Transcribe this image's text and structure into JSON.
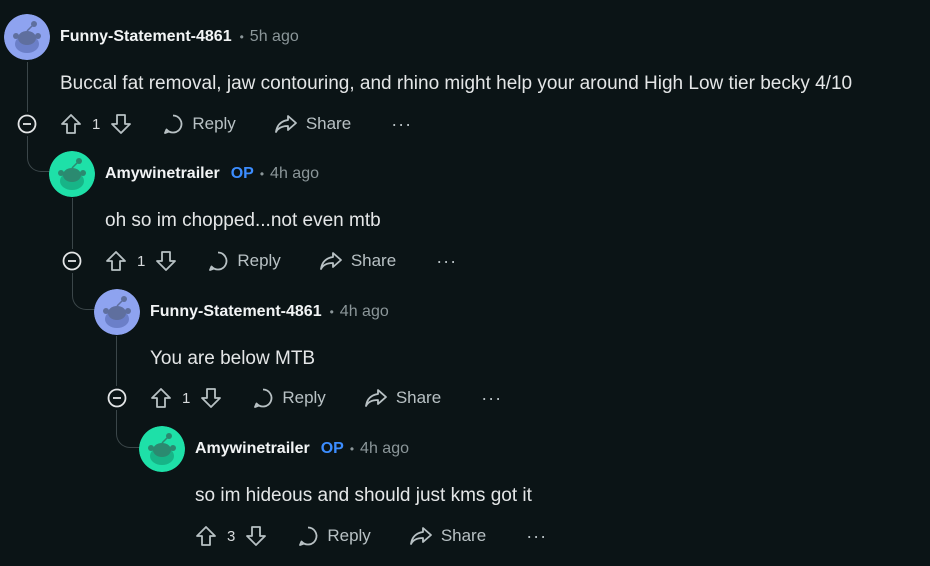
{
  "colors": {
    "bg": "#0b1416",
    "op": "#3c8dff",
    "avatar_blue": "#8ea3f0",
    "avatar_green": "#1ee0a8"
  },
  "comments": [
    {
      "username": "Funny-Statement-4861",
      "op": "",
      "time": "5h ago",
      "text": "Buccal fat removal, jaw contouring, and rhino might help your around High Low tier becky 4/10",
      "votes": "1",
      "reply": "Reply",
      "share": "Share",
      "more": "···",
      "avatar": "snoo-avatar-blue"
    },
    {
      "username": "Amywinetrailer",
      "op": "OP",
      "time": "4h ago",
      "text": "oh so im chopped...not even mtb",
      "votes": "1",
      "reply": "Reply",
      "share": "Share",
      "more": "···",
      "avatar": "snoo-avatar-green"
    },
    {
      "username": "Funny-Statement-4861",
      "op": "",
      "time": "4h ago",
      "text": "You are below MTB",
      "votes": "1",
      "reply": "Reply",
      "share": "Share",
      "more": "···",
      "avatar": "snoo-avatar-blue"
    },
    {
      "username": "Amywinetrailer",
      "op": "OP",
      "time": "4h ago",
      "text": "so im hideous and should just kms got it",
      "votes": "3",
      "reply": "Reply",
      "share": "Share",
      "more": "···",
      "avatar": "snoo-avatar-green"
    }
  ]
}
